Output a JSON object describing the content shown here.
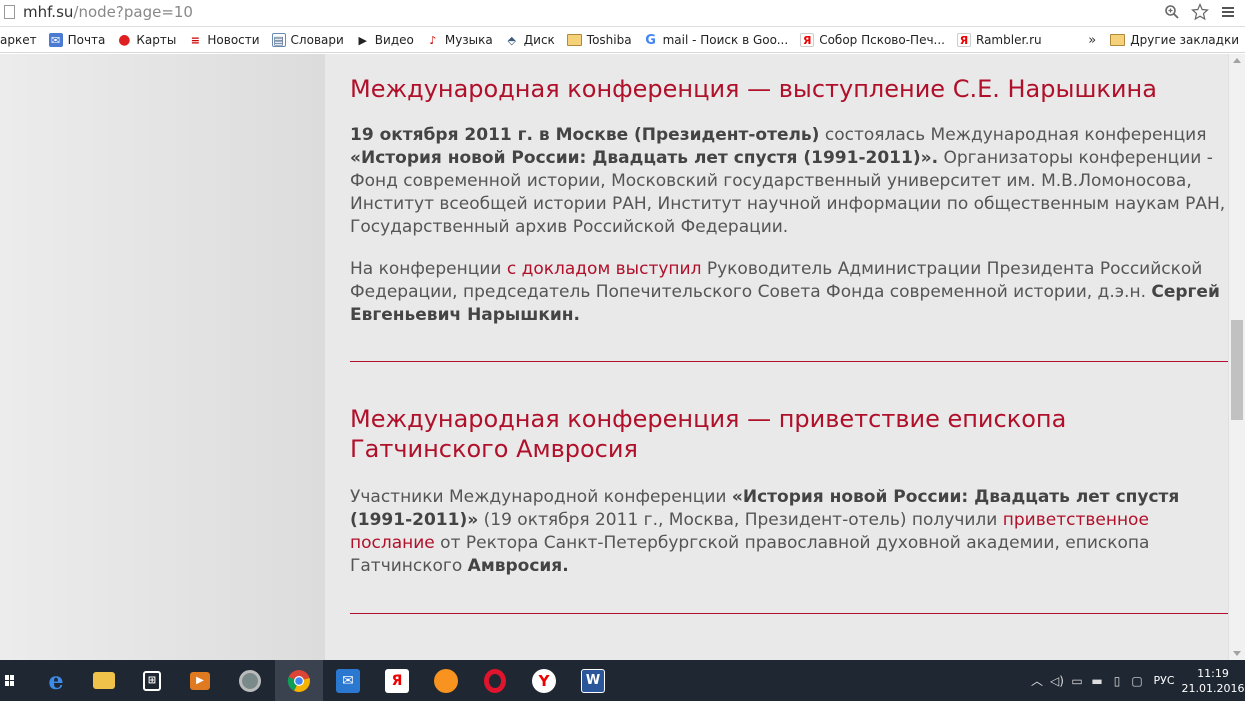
{
  "browser": {
    "url_host": "mhf.su",
    "url_path": "/node?page=10",
    "bookmarks": [
      {
        "label": "аркет",
        "icon": "market-icon"
      },
      {
        "label": "Почта",
        "icon": "mail-icon"
      },
      {
        "label": "Карты",
        "icon": "maps-icon"
      },
      {
        "label": "Новости",
        "icon": "news-icon"
      },
      {
        "label": "Словари",
        "icon": "dictionary-icon"
      },
      {
        "label": "Видео",
        "icon": "video-icon"
      },
      {
        "label": "Музыка",
        "icon": "music-icon"
      },
      {
        "label": "Диск",
        "icon": "disk-icon"
      },
      {
        "label": "Toshiba",
        "icon": "folder-icon"
      },
      {
        "label": "mail - Поиск в Goo...",
        "icon": "google-icon"
      },
      {
        "label": "Собор Псково-Печ...",
        "icon": "yandex-icon"
      },
      {
        "label": "Rambler.ru",
        "icon": "yandex-icon"
      }
    ],
    "more_label": "»",
    "other_bookmarks": "Другие закладки"
  },
  "articles": [
    {
      "title": "Международная конференция — выступление С.Е. Нарышкина",
      "p1_bold": "19 октября 2011 г. в Москве (Президент-отель)",
      "p1_text1": " состоялась Международная конференция ",
      "p1_bold2": "«История новой России: Двадцать лет спустя (1991-2011)».",
      "p1_text2": " Организаторы конференции - Фонд современной истории, Московский государственный университет им. М.В.Ломоносова, Институт всеобщей истории РАН, Институт научной информации по общественным наукам РАН, Государственный архив Российской Федерации.",
      "p2_text1": "На конференции ",
      "p2_link": "с докладом выступил",
      "p2_text2": " Руководитель Администрации Президента Российской Федерации, председатель Попечительского Совета Фонда современной истории, д.э.н. ",
      "p2_bold": "Сергей Евгеньевич Нарышкин."
    },
    {
      "title": "Международная конференция — приветствие епископа Гатчинского Амвросия",
      "p1_text1": "Участники Международной конференции ",
      "p1_bold": "«История новой России: Двадцать лет спустя (1991-2011)»",
      "p1_text2": " (19 октября 2011 г., Москва, Президент-отель) получили ",
      "p1_link": "приветственное послание",
      "p1_text3": " от Ректора Санкт-Петербургской православной духовной академии, епископа Гатчинского ",
      "p1_bold2": "Амвросия."
    }
  ],
  "taskbar": {
    "apps": [
      "windows-start-icon",
      "edge-icon",
      "explorer-icon",
      "store-icon",
      "media-icon",
      "app-circle-icon",
      "chrome-icon",
      "mail-app-icon",
      "yandex-icon",
      "odnoklassniki-icon",
      "opera-icon",
      "yandex-browser-icon",
      "word-icon"
    ],
    "lang": "РУС",
    "time": "11:19",
    "date": "21.01.2016"
  }
}
